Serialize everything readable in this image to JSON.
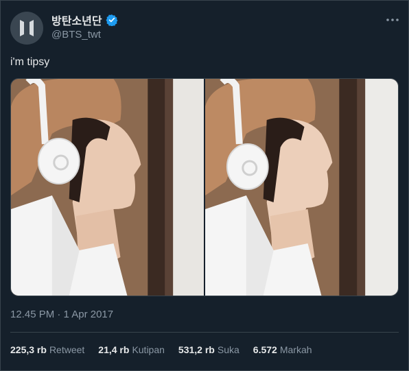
{
  "author": {
    "display_name": "방탄소년단",
    "handle": "@BTS_twt",
    "avatar_icon": "bts-logo-icon",
    "verified_icon": "verified-badge-icon",
    "verified_color": "#1d9bf0"
  },
  "tweet": {
    "text": "i'm tipsy",
    "timestamp": "12.45 PM · 1 Apr 2017"
  },
  "media": {
    "photos": [
      {
        "name": "photo-1"
      },
      {
        "name": "photo-2"
      }
    ]
  },
  "stats": [
    {
      "value": "225,3 rb",
      "label": "Retweet"
    },
    {
      "value": "21,4 rb",
      "label": "Kutipan"
    },
    {
      "value": "531,2 rb",
      "label": "Suka"
    },
    {
      "value": "6.572",
      "label": "Markah"
    }
  ],
  "colors": {
    "background": "#15202b",
    "text": "#e7e9ea",
    "muted": "#8b98a5",
    "border": "#38444d"
  }
}
